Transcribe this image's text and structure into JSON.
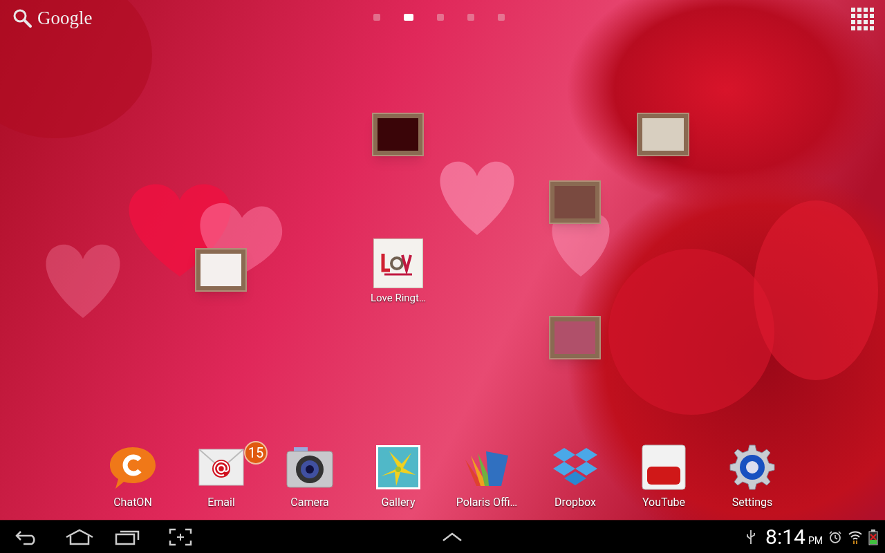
{
  "search": {
    "label": "Google"
  },
  "page_indicator": [
    {
      "selected": false
    },
    {
      "selected": true
    },
    {
      "selected": false
    },
    {
      "selected": false
    },
    {
      "selected": false
    }
  ],
  "desktop_shortcuts": [
    {
      "label": "Love Ringt…"
    }
  ],
  "dock": [
    {
      "label": "ChatON"
    },
    {
      "label": "Email",
      "badge": "15"
    },
    {
      "label": "Camera"
    },
    {
      "label": "Gallery"
    },
    {
      "label": "Polaris Offi…"
    },
    {
      "label": "Dropbox"
    },
    {
      "label": "YouTube"
    },
    {
      "label": "Settings"
    }
  ],
  "status_bar": {
    "time": "8:14",
    "meridiem": "PM"
  }
}
